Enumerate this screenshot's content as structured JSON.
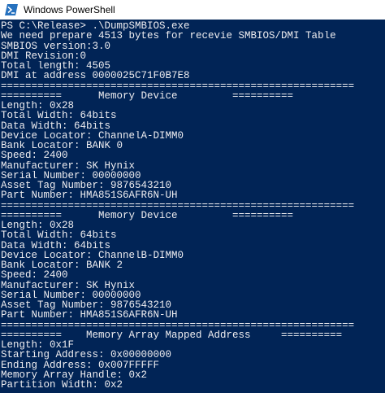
{
  "window": {
    "title": "Windows PowerShell",
    "icon": "powershell-icon"
  },
  "colors": {
    "console_background": "#012456",
    "console_text": "#eeedf0",
    "titlebar_background": "#ffffff"
  },
  "console": {
    "lines": [
      "PS C:\\Release> .\\DumpSMBIOS.exe",
      "We need prepare 4513 bytes for recevie SMBIOS/DMI Table",
      "SMBIOS version:3.0",
      "DMI Revision:0",
      "Total length: 4505",
      "DMI at address 0000025C71F0B7E8",
      "==========================================================",
      "==========      Memory Device         ==========",
      "Length: 0x28",
      "Total Width: 64bits",
      "Data Width: 64bits",
      "Device Locator: ChannelA-DIMM0",
      "Bank Locator: BANK 0",
      "Speed: 2400",
      "Manufacturer: SK Hynix",
      "Serial Number: 00000000",
      "Asset Tag Number: 9876543210",
      "Part Number: HMA851S6AFR6N-UH",
      "==========================================================",
      "==========      Memory Device         ==========",
      "Length: 0x28",
      "Total Width: 64bits",
      "Data Width: 64bits",
      "Device Locator: ChannelB-DIMM0",
      "Bank Locator: BANK 2",
      "Speed: 2400",
      "Manufacturer: SK Hynix",
      "Serial Number: 00000000",
      "Asset Tag Number: 9876543210",
      "Part Number: HMA851S6AFR6N-UH",
      "==========================================================",
      "==========    Memory Array Mapped Address     ==========",
      "Length: 0x1F",
      "Starting Address: 0x00000000",
      "Ending Address: 0x007FFFFF",
      "Memory Array Handle: 0x2",
      "Partition Width: 0x2"
    ]
  }
}
